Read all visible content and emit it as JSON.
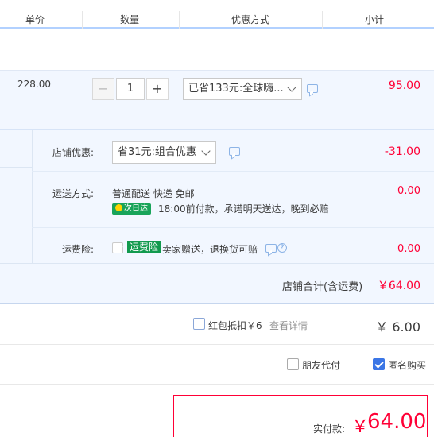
{
  "header": {
    "col_price": "单价",
    "col_qty": "数量",
    "col_discount": "优惠方式",
    "col_subtotal": "小计"
  },
  "item": {
    "unit_price": "228.00",
    "qty": "1",
    "minus": "−",
    "plus": "+",
    "discount_select": "已省133元:全球嗨...",
    "subtotal": "95.00"
  },
  "store": {
    "promo_label": "店铺优惠:",
    "promo_select": "省31元:组合优惠",
    "promo_amount": "-31.00",
    "shipping_label": "运送方式:",
    "shipping_method": "普通配送 快递 免邮",
    "shipping_badge": "次日达",
    "shipping_note": "18:00前付款，承诺明天送达，晚到必赔",
    "shipping_amount": "0.00",
    "insurance_label": "运费险:",
    "insurance_tag": "运费险",
    "insurance_text": "卖家赠送，退换货可赔",
    "insurance_amount": "0.00",
    "total_label": "店铺合计(含运费)",
    "total_value": "￥64.00"
  },
  "redpacket": {
    "label": "红包抵扣￥6",
    "details_link": "查看详情",
    "amount": "￥ 6.00"
  },
  "options": {
    "friend_pay": "朋友代付",
    "anonymous": "匿名购买"
  },
  "payment": {
    "label": "实付款:",
    "currency": "￥",
    "amount": "64.00"
  },
  "colors": {
    "accent_red": "#ff0036",
    "accent_blue": "#3b76e6",
    "panel_bg": "#f2f7ff",
    "badge_green": "#19a45a"
  },
  "icons": {
    "chat": "chat-bubble-icon",
    "help": "question-circle-icon",
    "chevron": "chevron-down-icon",
    "lightning": "lightning-icon"
  }
}
